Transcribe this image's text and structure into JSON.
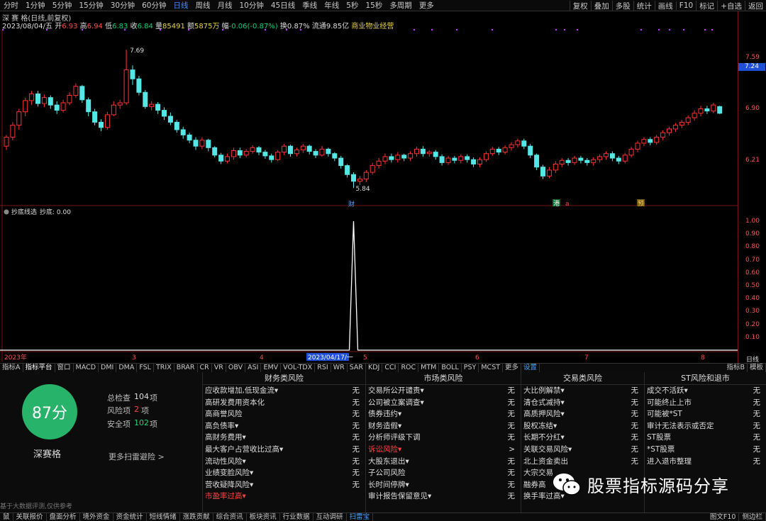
{
  "period_bar": [
    "分时",
    "1分钟",
    "5分钟",
    "15分钟",
    "30分钟",
    "60分钟",
    "日线",
    "周线",
    "月线",
    "10分钟",
    "45日线",
    "季线",
    "年线",
    "5秒",
    "15秒",
    "多周期",
    "更多"
  ],
  "period_active_index": 6,
  "right_tools": [
    "复权",
    "叠加",
    "多股",
    "统计",
    "画线",
    "F10",
    "标记",
    "+自选",
    "返回"
  ],
  "stock": {
    "title": "深 赛 格(日线,前复权)",
    "date": "2023/08/04/五",
    "open_label": "开",
    "open": "6.93",
    "high_label": "高",
    "high": "6.94",
    "low_label": "低",
    "low": "6.83",
    "close_label": "收",
    "close": "6.84",
    "vol_label": "量",
    "vol": "85491",
    "amt_label": "额",
    "amt": "5875万",
    "chg_label": "幅",
    "chg": "-0.06(-0.87%)",
    "turn_label": "换",
    "turn": "0.87%",
    "float_label": "流通",
    "float": "9.85亿",
    "sector": "商业物业经营"
  },
  "price_axis": {
    "ticks": [
      "7.59",
      "6.90",
      "6.21"
    ],
    "current": "7.24"
  },
  "chart_annotations": {
    "high_label": "7.69",
    "low_label": "5.84",
    "fin_marker": "财",
    "marker_green": "港",
    "marker_red": "a",
    "marker_yellow": "预"
  },
  "indicator": {
    "title": "抄底线选",
    "value_label": "抄底: 0.00",
    "ticks": [
      "1.00",
      "0.90",
      "0.80",
      "0.70",
      "0.60",
      "0.50",
      "0.40",
      "0.30",
      "0.20",
      "0.10"
    ]
  },
  "date_axis": {
    "labels": [
      "2023年",
      "3",
      "4",
      "2023/04/17/一",
      "5",
      "6",
      "7",
      "8"
    ],
    "right": "日线"
  },
  "tabs": [
    "指标A",
    "指标平台",
    "窗口",
    "MACD",
    "DMI",
    "DMA",
    "FSL",
    "TRIX",
    "BRAR",
    "CR",
    "VR",
    "OBV",
    "ASI",
    "EMV",
    "VOL-TDX",
    "RSI",
    "WR",
    "SAR",
    "KDJ",
    "CCI",
    "ROC",
    "MTM",
    "BOLL",
    "PSY",
    "MCST",
    "更多",
    "设置"
  ],
  "tabs_right": [
    "指标B",
    "模板"
  ],
  "risk": {
    "score": "87分",
    "name": "深赛格",
    "total_label": "总检查",
    "total": "104",
    "total_unit": "项",
    "risk_label": "风险项",
    "risk": "2",
    "risk_unit": "项",
    "safe_label": "安全项",
    "safe": "102",
    "safe_unit": "项",
    "more": "更多扫雷避险 >",
    "disclaimer": "基于大数据评测,仅供参考",
    "columns": [
      {
        "title": "财务类风险",
        "items": [
          {
            "label": "应收款增加,低现金流▾",
            "value": "无"
          },
          {
            "label": "高研发费用资本化",
            "value": "无"
          },
          {
            "label": "高商誉风险",
            "value": "无"
          },
          {
            "label": "高负债率▾",
            "value": "无"
          },
          {
            "label": "高财务费用▾",
            "value": "无"
          },
          {
            "label": "最大客户占营收比过高▾",
            "value": "无"
          },
          {
            "label": "流动性风险▾",
            "value": "无"
          },
          {
            "label": "业绩变脸风险▾",
            "value": "无"
          },
          {
            "label": "营收疑降风险▾",
            "value": "无"
          },
          {
            "label": "市盈率过高▾",
            "value": "",
            "red": true
          }
        ]
      },
      {
        "title": "市场类风险",
        "items": [
          {
            "label": "交易所公开谴责▾",
            "value": "无"
          },
          {
            "label": "公司被立案调查▾",
            "value": "无"
          },
          {
            "label": "债券违约▾",
            "value": "无"
          },
          {
            "label": "财务造假▾",
            "value": "无"
          },
          {
            "label": "分析师评级下调",
            "value": "无"
          },
          {
            "label": "诉讼风险▾",
            "value": ">",
            "red": true
          },
          {
            "label": "大股东退出▾",
            "value": "无"
          },
          {
            "label": "子公司风险",
            "value": "无"
          },
          {
            "label": "长时间停牌▾",
            "value": "无"
          },
          {
            "label": "审计报告保留意见▾",
            "value": "无"
          }
        ]
      },
      {
        "title": "交易类风险",
        "items": [
          {
            "label": "大比例解禁▾",
            "value": "无"
          },
          {
            "label": "清仓式减持▾",
            "value": "无"
          },
          {
            "label": "高质押风险▾",
            "value": "无"
          },
          {
            "label": "股权冻结▾",
            "value": "无"
          },
          {
            "label": "长期不分红▾",
            "value": "无"
          },
          {
            "label": "关联交易风险▾",
            "value": "无"
          },
          {
            "label": "北上资金卖出",
            "value": "无"
          },
          {
            "label": "大宗交易",
            "value": ""
          },
          {
            "label": "融券高",
            "value": ""
          },
          {
            "label": "换手率过高▾",
            "value": ""
          }
        ]
      },
      {
        "title": "ST风险和退市",
        "items": [
          {
            "label": "成交不活跃▾",
            "value": "无"
          },
          {
            "label": "可能终止上市",
            "value": "无"
          },
          {
            "label": "可能被*ST",
            "value": "无"
          },
          {
            "label": "审计无法表示或否定",
            "value": "无"
          },
          {
            "label": "ST股票",
            "value": "无"
          },
          {
            "label": "*ST股票",
            "value": "无"
          },
          {
            "label": "进入退市整理",
            "value": "无"
          }
        ]
      }
    ]
  },
  "statusbar": [
    "鼠",
    "关联报价",
    "盘面分析",
    "境外资金",
    "资金统计",
    "短线情绪",
    "涨跌贡献",
    "综合资讯",
    "板块资讯",
    "行业数据",
    "互动调研",
    "扫雷宝"
  ],
  "statusbar_right": [
    "图文F10",
    "侧边栏"
  ],
  "watermark": "股票指标源码分享",
  "colors": {
    "up": "#ff3232",
    "down": "#55e6e6",
    "score": "#27b36a",
    "accent": "#3d8fff"
  },
  "chart_data": {
    "type": "candlestick",
    "y_range": [
      5.7,
      7.9
    ],
    "candles": [
      [
        6.4,
        6.52,
        6.35,
        6.55
      ],
      [
        6.52,
        6.68,
        6.48,
        6.72
      ],
      [
        6.68,
        6.86,
        6.62,
        6.9
      ],
      [
        6.86,
        7.01,
        6.8,
        7.05
      ],
      [
        7.01,
        7.1,
        6.95,
        7.14
      ],
      [
        7.1,
        6.97,
        6.93,
        7.14
      ],
      [
        6.97,
        7.05,
        6.92,
        7.09
      ],
      [
        7.05,
        6.95,
        6.9,
        7.08
      ],
      [
        6.95,
        6.88,
        6.83,
        7.0
      ],
      [
        6.88,
        6.98,
        6.85,
        7.02
      ],
      [
        6.98,
        7.08,
        6.95,
        7.12
      ],
      [
        7.08,
        7.2,
        7.05,
        7.24
      ],
      [
        7.2,
        7.02,
        6.98,
        7.22
      ],
      [
        7.02,
        6.86,
        6.8,
        7.05
      ],
      [
        6.86,
        6.72,
        6.68,
        6.9
      ],
      [
        6.72,
        6.65,
        6.6,
        6.76
      ],
      [
        6.65,
        6.82,
        6.62,
        6.86
      ],
      [
        6.82,
        6.95,
        6.8,
        7.0
      ],
      [
        6.95,
        6.98,
        6.9,
        7.02
      ],
      [
        6.98,
        7.42,
        6.95,
        7.69
      ],
      [
        7.42,
        7.3,
        7.22,
        7.48
      ],
      [
        7.3,
        7.12,
        7.08,
        7.34
      ],
      [
        7.12,
        6.93,
        6.9,
        7.15
      ],
      [
        6.93,
        6.96,
        6.88,
        7.0
      ],
      [
        6.96,
        6.88,
        6.83,
        6.99
      ],
      [
        6.88,
        6.8,
        6.75,
        6.92
      ],
      [
        6.8,
        6.72,
        6.68,
        6.85
      ],
      [
        6.72,
        6.62,
        6.58,
        6.75
      ],
      [
        6.62,
        6.55,
        6.5,
        6.66
      ],
      [
        6.55,
        6.48,
        6.44,
        6.58
      ],
      [
        6.48,
        6.4,
        6.35,
        6.52
      ],
      [
        6.4,
        6.48,
        6.36,
        6.52
      ],
      [
        6.48,
        6.38,
        6.33,
        6.5
      ],
      [
        6.38,
        6.28,
        6.25,
        6.4
      ],
      [
        6.28,
        6.2,
        6.16,
        6.31
      ],
      [
        6.2,
        6.26,
        6.17,
        6.3
      ],
      [
        6.26,
        6.34,
        6.22,
        6.38
      ],
      [
        6.34,
        6.28,
        6.24,
        6.38
      ],
      [
        6.28,
        6.33,
        6.25,
        6.36
      ],
      [
        6.33,
        6.38,
        6.3,
        6.41
      ],
      [
        6.38,
        6.32,
        6.28,
        6.4
      ],
      [
        6.32,
        6.27,
        6.23,
        6.35
      ],
      [
        6.27,
        6.22,
        6.18,
        6.3
      ],
      [
        6.22,
        6.32,
        6.2,
        6.35
      ],
      [
        6.32,
        6.4,
        6.28,
        6.43
      ],
      [
        6.4,
        6.3,
        6.26,
        6.42
      ],
      [
        6.3,
        6.35,
        6.26,
        6.38
      ],
      [
        6.35,
        6.4,
        6.31,
        6.43
      ],
      [
        6.4,
        6.33,
        6.29,
        6.42
      ],
      [
        6.33,
        6.28,
        6.24,
        6.36
      ],
      [
        6.28,
        6.36,
        6.26,
        6.4
      ],
      [
        6.36,
        6.3,
        6.26,
        6.38
      ],
      [
        6.3,
        6.24,
        6.2,
        6.32
      ],
      [
        6.24,
        6.14,
        6.1,
        6.27
      ],
      [
        6.14,
        6.02,
        5.98,
        6.16
      ],
      [
        6.02,
        5.93,
        5.84,
        6.05
      ],
      [
        5.93,
        5.96,
        5.88,
        6.0
      ],
      [
        5.96,
        6.05,
        5.92,
        6.08
      ],
      [
        6.05,
        6.14,
        6.02,
        6.18
      ],
      [
        6.14,
        6.2,
        6.1,
        6.24
      ],
      [
        6.2,
        6.26,
        6.16,
        6.3
      ],
      [
        6.26,
        6.22,
        6.18,
        6.3
      ],
      [
        6.22,
        6.28,
        6.18,
        6.32
      ],
      [
        6.28,
        6.24,
        6.2,
        6.3
      ],
      [
        6.24,
        6.3,
        6.2,
        6.33
      ],
      [
        6.3,
        6.36,
        6.26,
        6.39
      ],
      [
        6.36,
        6.3,
        6.26,
        6.4
      ],
      [
        6.3,
        6.32,
        6.26,
        6.35
      ],
      [
        6.32,
        6.26,
        6.22,
        6.35
      ],
      [
        6.26,
        6.18,
        6.14,
        6.29
      ],
      [
        6.18,
        6.24,
        6.15,
        6.27
      ],
      [
        6.24,
        6.21,
        6.17,
        6.27
      ],
      [
        6.21,
        6.26,
        6.17,
        6.29
      ],
      [
        6.26,
        6.22,
        6.18,
        6.29
      ],
      [
        6.22,
        6.16,
        6.12,
        6.25
      ],
      [
        6.16,
        6.22,
        6.12,
        6.25
      ],
      [
        6.22,
        6.3,
        6.19,
        6.33
      ],
      [
        6.3,
        6.36,
        6.27,
        6.39
      ],
      [
        6.36,
        6.32,
        6.28,
        6.39
      ],
      [
        6.32,
        6.38,
        6.29,
        6.41
      ],
      [
        6.38,
        6.42,
        6.34,
        6.45
      ],
      [
        6.42,
        6.47,
        6.38,
        6.5
      ],
      [
        6.47,
        6.4,
        6.36,
        6.5
      ],
      [
        6.4,
        6.28,
        6.24,
        6.43
      ],
      [
        6.28,
        6.12,
        6.08,
        6.3
      ],
      [
        6.12,
        6.0,
        5.96,
        6.15
      ],
      [
        6.0,
        6.08,
        5.97,
        6.12
      ],
      [
        6.08,
        6.16,
        6.04,
        6.2
      ],
      [
        6.16,
        6.21,
        6.12,
        6.24
      ],
      [
        6.21,
        6.18,
        6.14,
        6.24
      ],
      [
        6.18,
        6.24,
        6.15,
        6.27
      ],
      [
        6.24,
        6.21,
        6.17,
        6.27
      ],
      [
        6.21,
        6.18,
        6.14,
        6.24
      ],
      [
        6.18,
        6.22,
        6.14,
        6.25
      ],
      [
        6.22,
        6.26,
        6.18,
        6.29
      ],
      [
        6.26,
        6.3,
        6.22,
        6.33
      ],
      [
        6.3,
        6.24,
        6.2,
        6.33
      ],
      [
        6.24,
        6.2,
        6.16,
        6.27
      ],
      [
        6.2,
        6.28,
        6.17,
        6.31
      ],
      [
        6.28,
        6.36,
        6.25,
        6.39
      ],
      [
        6.36,
        6.44,
        6.32,
        6.47
      ],
      [
        6.44,
        6.49,
        6.4,
        6.52
      ],
      [
        6.49,
        6.45,
        6.41,
        6.52
      ],
      [
        6.45,
        6.52,
        6.42,
        6.55
      ],
      [
        6.52,
        6.58,
        6.48,
        6.61
      ],
      [
        6.58,
        6.63,
        6.54,
        6.66
      ],
      [
        6.63,
        6.68,
        6.59,
        6.71
      ],
      [
        6.68,
        6.72,
        6.64,
        6.75
      ],
      [
        6.72,
        6.78,
        6.68,
        6.81
      ],
      [
        6.78,
        6.84,
        6.74,
        6.88
      ],
      [
        6.84,
        6.9,
        6.8,
        6.94
      ],
      [
        6.9,
        6.87,
        6.83,
        6.94
      ],
      [
        6.87,
        6.95,
        6.84,
        6.98
      ],
      [
        6.93,
        6.84,
        6.83,
        6.94
      ]
    ],
    "indicator_series": {
      "peak_index": 55,
      "peak_value": 1.0,
      "baseline": 0.0
    }
  }
}
